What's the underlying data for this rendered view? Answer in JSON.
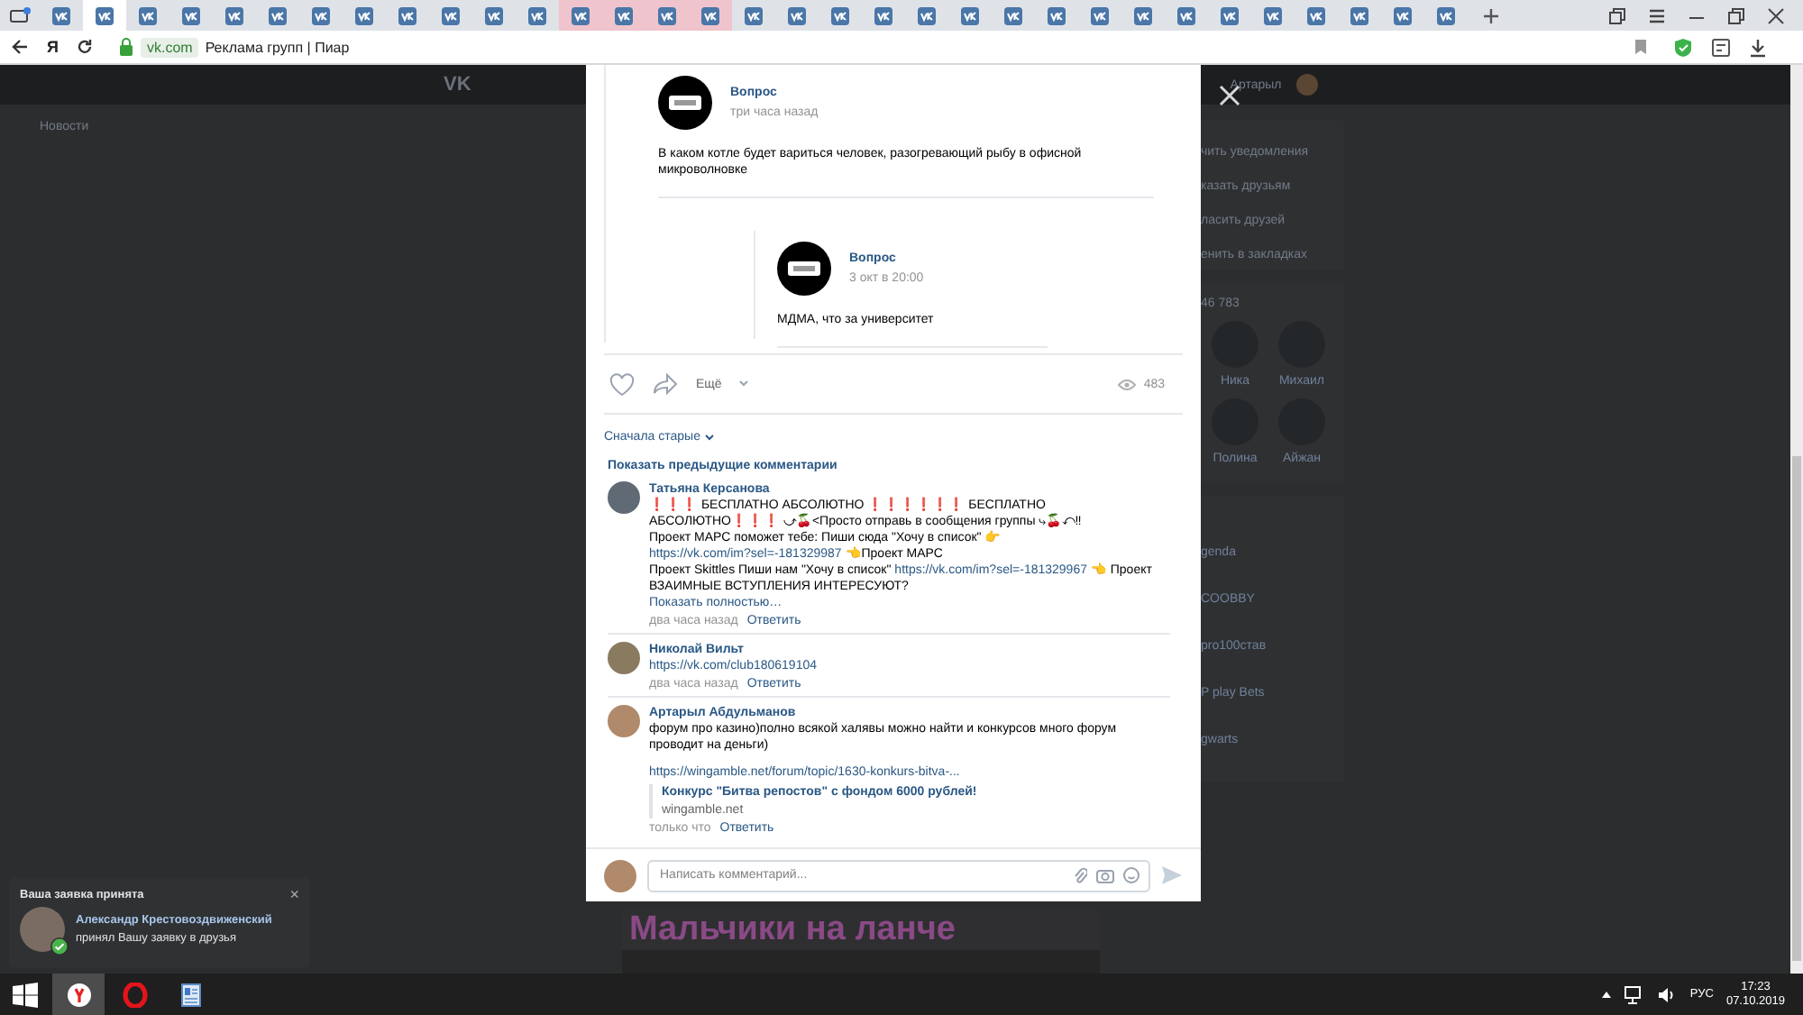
{
  "browser": {
    "tabs": [
      {
        "selected": false,
        "highlighted": false
      },
      {
        "selected": true,
        "highlighted": false
      },
      {
        "selected": false,
        "highlighted": false
      },
      {
        "selected": false,
        "highlighted": false
      },
      {
        "selected": false,
        "highlighted": false
      },
      {
        "selected": false,
        "highlighted": false
      },
      {
        "selected": false,
        "highlighted": false
      },
      {
        "selected": false,
        "highlighted": false
      },
      {
        "selected": false,
        "highlighted": false
      },
      {
        "selected": false,
        "highlighted": false
      },
      {
        "selected": false,
        "highlighted": false
      },
      {
        "selected": false,
        "highlighted": false
      },
      {
        "selected": false,
        "highlighted": true
      },
      {
        "selected": false,
        "highlighted": true
      },
      {
        "selected": false,
        "highlighted": true
      },
      {
        "selected": false,
        "highlighted": true
      },
      {
        "selected": false,
        "highlighted": false
      },
      {
        "selected": false,
        "highlighted": false
      },
      {
        "selected": false,
        "highlighted": false
      },
      {
        "selected": false,
        "highlighted": false
      },
      {
        "selected": false,
        "highlighted": false
      },
      {
        "selected": false,
        "highlighted": false
      },
      {
        "selected": false,
        "highlighted": false
      },
      {
        "selected": false,
        "highlighted": false
      },
      {
        "selected": false,
        "highlighted": false
      },
      {
        "selected": false,
        "highlighted": false
      },
      {
        "selected": false,
        "highlighted": false
      },
      {
        "selected": false,
        "highlighted": false
      },
      {
        "selected": false,
        "highlighted": false
      },
      {
        "selected": false,
        "highlighted": false
      },
      {
        "selected": false,
        "highlighted": false
      },
      {
        "selected": false,
        "highlighted": false
      },
      {
        "selected": false,
        "highlighted": false
      }
    ],
    "home_label": "Я",
    "domain": "vk.com",
    "page_title": "Реклама групп | Пиар"
  },
  "header": {
    "logo": "VK",
    "user": "Артарыл"
  },
  "left_menu": [
    "Новости"
  ],
  "right_menu": [
    "чить уведомления",
    "казать друзьям",
    "ласить друзей",
    "енить в закладках"
  ],
  "friends": {
    "count": "46 783",
    "items": [
      {
        "name": "Ника"
      },
      {
        "name": "Михаил"
      },
      {
        "name": "Полина"
      },
      {
        "name": "Айжан"
      }
    ]
  },
  "groups": [
    "genda",
    "COOBBY",
    "pro100став",
    "P play Bets",
    "gwarts"
  ],
  "banner": {
    "title": "Мальчики на ланче"
  },
  "modal": {
    "post": {
      "author": "Вопрос",
      "time": "три часа назад",
      "text": "В каком котле будет вариться человек, разогревающий рыбу в офисной микроволновке"
    },
    "repost": {
      "author": "Вопрос",
      "time": "3 окт в 20:00",
      "text": "МДМА, что за университет"
    },
    "actions": {
      "liked": false,
      "more": "Ещё",
      "views": "483"
    },
    "sort": "Сначала старые",
    "show_previous": "Показать предыдущие комментарии",
    "comments": [
      {
        "author": "Татьяна Керсанова",
        "paragraphs": [
          [
            {
              "kind": "text",
              "text": "❗❗❗ БЕСПЛАТНО АБСОЛЮТНО ❗❗❗❗❗❗ БЕСПЛАТНО АБСОЛЮТНО❗❗❗ ⤻🍒<Просто отправь в сообщения группы ⤷🍒⤺‼"
            }
          ],
          [
            {
              "kind": "text",
              "text": "Проект МАРС поможет тебе: Пиши сюда \"Хочу в список\" 👉 "
            },
            {
              "kind": "link",
              "text": "https://vk.com/im?sel=-181329987"
            },
            {
              "kind": "text",
              "text": " 👈Проект МАРС"
            }
          ],
          [
            {
              "kind": "text",
              "text": "Проект Skittles Пиши нам \"Хочу в список\" "
            },
            {
              "kind": "link",
              "text": "https://vk.com/im?sel=-181329967"
            },
            {
              "kind": "text",
              "text": " 👈 Проект ВЗАИМНЫЕ ВСТУПЛЕНИЯ ИНТЕРЕСУЮТ?"
            }
          ]
        ],
        "show_more": "Показать полностью…",
        "time": "два часа назад",
        "reply": "Ответить"
      },
      {
        "author": "Николай Вильт",
        "paragraphs": [
          [
            {
              "kind": "link",
              "text": "https://vk.com/club180619104"
            }
          ]
        ],
        "time": "два часа назад",
        "reply": "Ответить"
      },
      {
        "author": "Артарыл Абдульманов",
        "paragraphs": [
          [
            {
              "kind": "text",
              "text": "форум про казино)полно всякой халявы можно найти и конкурсов много форум проводит на деньги)"
            }
          ]
        ],
        "attachment": {
          "url": "https://wingamble.net/forum/topic/1630-konkurs-bitva-...",
          "title": "Конкурс \"Битва репостов\" с фондом 6000 рублей!",
          "domain": "wingamble.net"
        },
        "time": "только что",
        "reply": "Ответить"
      }
    ],
    "composer": {
      "placeholder": "Написать комментарий..."
    }
  },
  "notification": {
    "title": "Ваша заявка принята",
    "close": "×",
    "name": "Александр Крестовоздвиженский",
    "text": "принял Вашу заявку в друзья",
    "accepted": true
  },
  "taskbar": {
    "apps": [
      {
        "kind": "yandex",
        "active": true
      },
      {
        "kind": "opera",
        "active": false
      },
      {
        "kind": "document",
        "active": false
      }
    ],
    "language": "РУС",
    "time": "17:23",
    "date": "07.10.2019"
  }
}
